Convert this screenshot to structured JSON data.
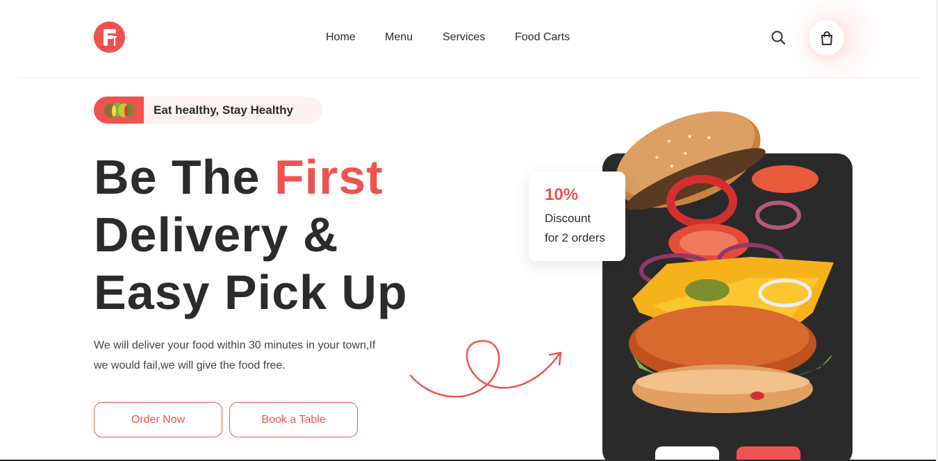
{
  "brand": {
    "logo_letter": "F",
    "accent": "#ef5350"
  },
  "nav": {
    "items": [
      "Home",
      "Menu",
      "Services",
      "Food Carts"
    ]
  },
  "header": {
    "search_icon": "search-icon",
    "cart_icon": "shopping-bag-icon"
  },
  "tagline": {
    "text": "Eat healthy, Stay Healthy"
  },
  "hero": {
    "title_part1": "Be The ",
    "title_accent": "First",
    "title_line2": "Delivery &",
    "title_line3": "Easy Pick Up",
    "description": "We will deliver your food within 30 minutes in your town,If we would fail,we will give the food free."
  },
  "buttons": {
    "order": "Order Now",
    "book": "Book a Table"
  },
  "discount": {
    "percent": "10%",
    "line1": "Discount",
    "line2": "for 2 orders"
  },
  "colors": {
    "accent": "#ef5350",
    "dark_card": "#2a2a2a",
    "text": "#2b2b2b"
  }
}
